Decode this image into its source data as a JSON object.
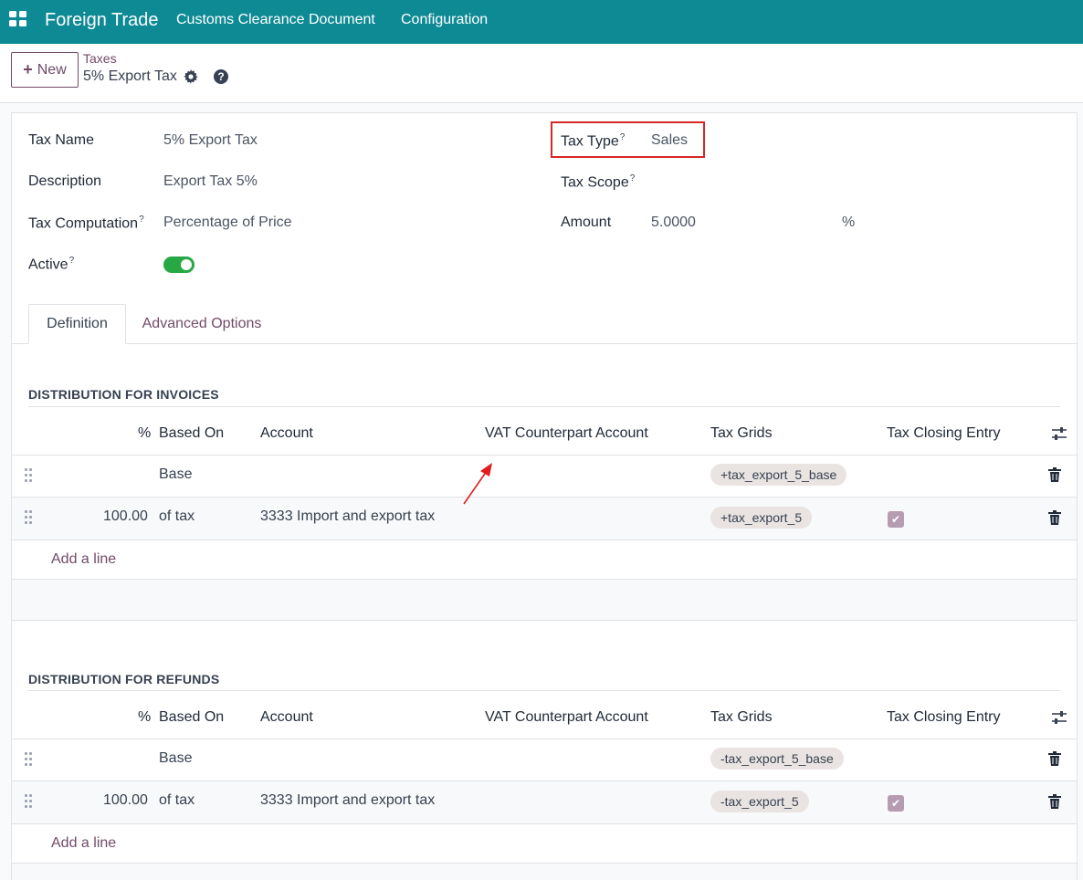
{
  "nav": {
    "brand": "Foreign Trade",
    "menu": [
      "Customs Clearance Document",
      "Configuration"
    ]
  },
  "control": {
    "new_label": "New",
    "breadcrumb_parent": "Taxes",
    "breadcrumb_current": "5% Export Tax"
  },
  "form": {
    "tax_name_label": "Tax Name",
    "tax_name_value": "5% Export Tax",
    "description_label": "Description",
    "description_value": "Export Tax 5%",
    "tax_computation_label": "Tax Computation",
    "tax_computation_value": "Percentage of Price",
    "active_label": "Active",
    "active_value": true,
    "tax_type_label": "Tax Type",
    "tax_type_value": "Sales",
    "tax_scope_label": "Tax Scope",
    "tax_scope_value": "",
    "amount_label": "Amount",
    "amount_value": "5.0000",
    "amount_unit": "%",
    "help_mark": "?"
  },
  "tabs": [
    "Definition",
    "Advanced Options"
  ],
  "columns": [
    "%",
    "Based On",
    "Account",
    "VAT Counterpart Account",
    "Tax Grids",
    "Tax Closing Entry"
  ],
  "invoices": {
    "title": "DISTRIBUTION FOR INVOICES",
    "rows": [
      {
        "percent": "",
        "based_on": "Base",
        "account": "",
        "vat": "",
        "grid": "+tax_export_5_base",
        "closing": false
      },
      {
        "percent": "100.00",
        "based_on": "of tax",
        "account": "3333 Import and export tax",
        "vat": "",
        "grid": "+tax_export_5",
        "closing": true
      }
    ],
    "add_line": "Add a line"
  },
  "refunds": {
    "title": "DISTRIBUTION FOR REFUNDS",
    "rows": [
      {
        "percent": "",
        "based_on": "Base",
        "account": "",
        "vat": "",
        "grid": "-tax_export_5_base",
        "closing": false
      },
      {
        "percent": "100.00",
        "based_on": "of tax",
        "account": "3333 Import and export tax",
        "vat": "",
        "grid": "-tax_export_5",
        "closing": true
      }
    ],
    "add_line": "Add a line"
  },
  "colors": {
    "nav": "#0e8a95",
    "accent": "#714b67",
    "highlight": "#d62828",
    "toggle_on": "#28a745"
  }
}
